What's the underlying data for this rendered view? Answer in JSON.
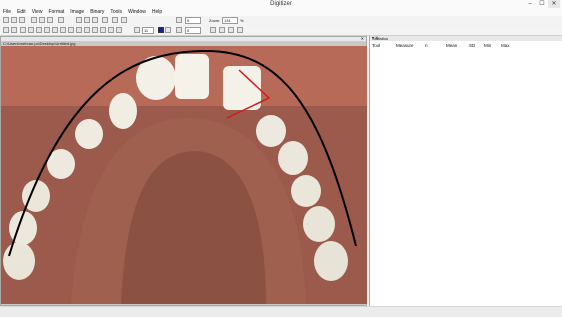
{
  "window": {
    "title": "Digitizer",
    "minimize": "–",
    "maximize": "☐",
    "close": "✕"
  },
  "menu": [
    "File",
    "Edit",
    "View",
    "Format",
    "Image",
    "Binary",
    "Tools",
    "Window",
    "Help"
  ],
  "toolbar": {
    "spin1_value": "0",
    "zoom_label": "Zoom:",
    "zoom_value": "131",
    "zoom_unit": "%",
    "spin2_value": "0",
    "line_width_value": "11",
    "draw_color": "#1a1aa6"
  },
  "document": {
    "path": "C:\\Users\\mehran.pc\\Desktop\\Untitled.jpg",
    "close": "✕",
    "image": "dental-arch-photo",
    "overlay": {
      "arch_curve_color": "#000000",
      "measure_lines_color": "#d41a1a"
    }
  },
  "statistics": {
    "title": "Statistics",
    "controls": "▾ ✕",
    "columns": [
      "Tool",
      "Measure",
      "n",
      "Mean",
      "SD",
      "Min",
      "Max"
    ]
  }
}
